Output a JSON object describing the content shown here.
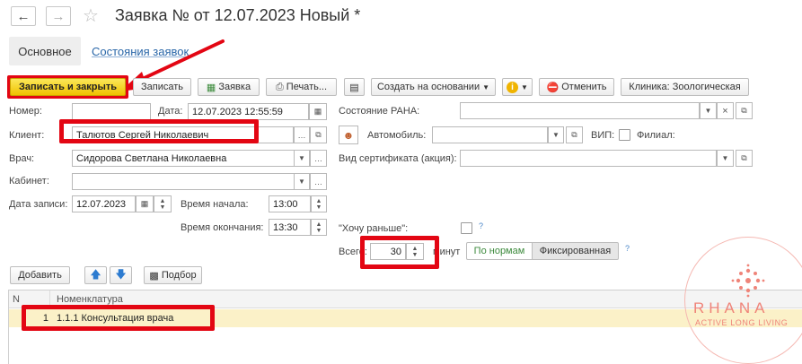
{
  "window": {
    "title": "Заявка №  от 12.07.2023 Новый *"
  },
  "tabs": {
    "main": "Основное",
    "states": "Состояния заявок"
  },
  "toolbar": {
    "save_close": "Записать и закрыть",
    "save": "Записать",
    "request": "Заявка",
    "print": "Печать...",
    "create_based": "Создать на основании",
    "cancel": "Отменить",
    "clinic": "Клиника: Зоологическая"
  },
  "form": {
    "number_label": "Номер:",
    "number_value": "",
    "date_label": "Дата:",
    "date_value": "12.07.2023 12:55:59",
    "client_label": "Клиент:",
    "client_value": "Талютов Сергей Николаевич",
    "doctor_label": "Врач:",
    "doctor_value": "Сидорова Светлана Николаевна",
    "cabinet_label": "Кабинет:",
    "cabinet_value": "",
    "record_date_label": "Дата записи:",
    "record_date_value": "12.07.2023",
    "start_time_label": "Время начала:",
    "start_time_value": "13:00",
    "end_time_label": "Время окончания:",
    "end_time_value": "13:30",
    "rana_state_label": "Состояние РАНА:",
    "rana_state_value": "",
    "car_label": "Автомобиль:",
    "car_value": "",
    "vip_label": "ВИП:",
    "branch_label": "Филиал:",
    "cert_label": "Вид сертификата (акция):",
    "cert_value": "",
    "want_earlier_label": "\"Хочу раньше\":",
    "total_label": "Всего:",
    "total_value": "30",
    "minutes_label": "минут",
    "by_norms": "По нормам",
    "fixed": "Фиксированная",
    "help_mark": "?"
  },
  "table_toolbar": {
    "add": "Добавить",
    "pick": "Подбор"
  },
  "table": {
    "col_n": "N",
    "col_item": "Номенклатура",
    "rows": [
      {
        "n": "1",
        "item": "1.1.1 Консультация врача"
      }
    ]
  },
  "watermark": {
    "brand": "RHANA",
    "tagline": "ACTIVE LONG LIVING"
  },
  "colors": {
    "primary_button": "#f5d000",
    "annotation_red": "#e30613",
    "link_blue": "#2966a8",
    "selected_row": "#fbf1c8",
    "watermark": "#f08a80"
  }
}
